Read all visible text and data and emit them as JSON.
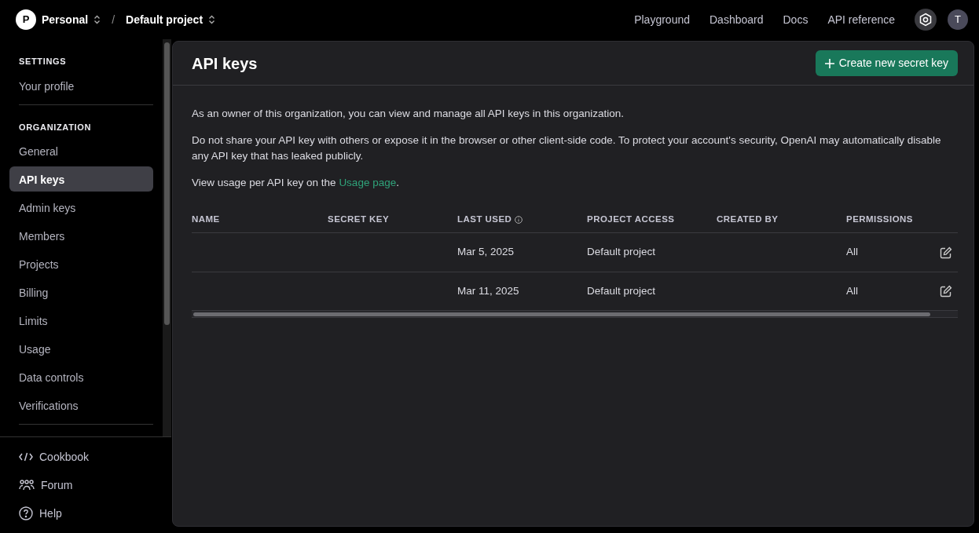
{
  "topbar": {
    "org_avatar": "P",
    "org_name": "Personal",
    "separator": "/",
    "project": "Default project",
    "links": [
      "Playground",
      "Dashboard",
      "Docs",
      "API reference"
    ],
    "user_avatar": "T"
  },
  "sidebar": {
    "sections": [
      {
        "heading": "SETTINGS",
        "items": [
          {
            "label": "Your profile",
            "selected": false
          }
        ]
      },
      {
        "heading": "ORGANIZATION",
        "items": [
          {
            "label": "General",
            "selected": false
          },
          {
            "label": "API keys",
            "selected": true
          },
          {
            "label": "Admin keys",
            "selected": false
          },
          {
            "label": "Members",
            "selected": false
          },
          {
            "label": "Projects",
            "selected": false
          },
          {
            "label": "Billing",
            "selected": false
          },
          {
            "label": "Limits",
            "selected": false
          },
          {
            "label": "Usage",
            "selected": false
          },
          {
            "label": "Data controls",
            "selected": false
          },
          {
            "label": "Verifications",
            "selected": false
          }
        ]
      }
    ],
    "footer_links": [
      {
        "label": "Cookbook",
        "kind": "code"
      },
      {
        "label": "Forum",
        "kind": "people"
      },
      {
        "label": "Help",
        "kind": "help"
      }
    ]
  },
  "page": {
    "title": "API keys",
    "create_button": "Create new secret key",
    "paragraphs": [
      "As an owner of this organization, you can view and manage all API keys in this organization.",
      "Do not share your API key with others or expose it in the browser or other client-side code. To protect your account's security, OpenAI may automatically disable any API key that has leaked publicly."
    ],
    "usage_note": {
      "before": "View usage per API key on the ",
      "link": "Usage page",
      "after": "."
    },
    "table": {
      "columns": [
        {
          "label": "NAME",
          "info": false
        },
        {
          "label": "SECRET KEY",
          "info": false
        },
        {
          "label": "LAST USED",
          "info": true
        },
        {
          "label": "PROJECT ACCESS",
          "info": false
        },
        {
          "label": "CREATED BY",
          "info": false
        },
        {
          "label": "PERMISSIONS",
          "info": false
        }
      ],
      "rows": [
        {
          "last_used": "Mar 5, 2025",
          "project_access": "Default project",
          "permissions": "All"
        },
        {
          "last_used": "Mar 11, 2025",
          "project_access": "Default project",
          "permissions": "All"
        }
      ]
    }
  }
}
